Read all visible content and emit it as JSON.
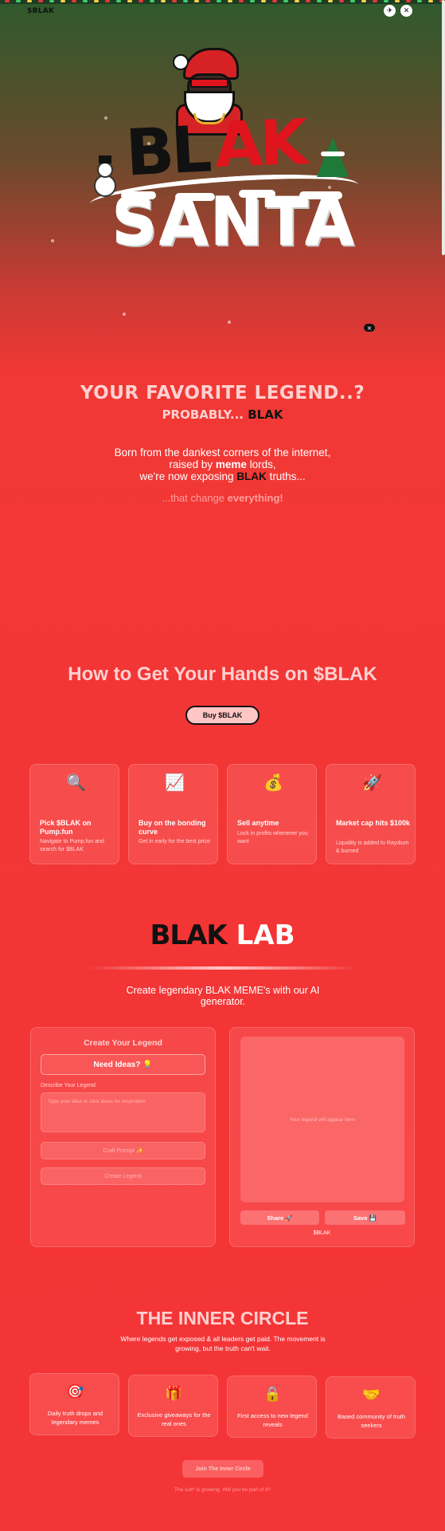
{
  "brand": {
    "prefix": "$",
    "name": "BLAK"
  },
  "header": {
    "telegram_icon": "telegram-icon",
    "x_icon": "x-logo-icon",
    "x_label": "✕",
    "telegram_label": "✈"
  },
  "hero": {
    "logo_bl": "BL",
    "logo_ak": "AK",
    "logo_santa": "SANTA"
  },
  "close_chip": "×",
  "tagline": {
    "line1": "YOUR FAVORITE LEGEND..?",
    "line2_prefix": "PROBABLY... ",
    "line2_blak": "BLAK"
  },
  "intro": {
    "line1": "Born from the dankest corners of the internet,",
    "line2_pre": "raised by ",
    "line2_bold": "meme",
    "line2_post": " lords,",
    "line3_pre": "we're now exposing ",
    "line3_blak": "BLAK",
    "line3_post": " truths...",
    "tail_pre": "...that change ",
    "tail_bold": "everything!"
  },
  "howto": {
    "title": "How to Get Your Hands on $BLAK",
    "buy_label": "Buy $BLAK",
    "steps": [
      {
        "icon": "🔍",
        "title": "Pick $BLAK on Pump.fun",
        "desc": "Navigate to Pump.fun and search for $BLAK"
      },
      {
        "icon": "📈",
        "title": "Buy on the bonding curve",
        "desc": "Get in early for the best price"
      },
      {
        "icon": "💰",
        "title": "Sell anytime",
        "desc": "Lock in profits whenever you want"
      },
      {
        "icon": "🚀",
        "title": "Market cap hits $100k",
        "desc": "Liquidity is added to Raydium & burned"
      }
    ]
  },
  "lab": {
    "title_blak": "BLAK",
    "title_lab": " LAB",
    "description": "Create legendary BLAK MEME's with our AI generator.",
    "panel_title": "Create Your Legend",
    "ideas_label": "Need Ideas? 💡",
    "field_label": "Describe Your Legend",
    "textarea_placeholder": "Type your idea or click ideas for inspiration",
    "craft_label": "Craft Prompt ✨",
    "create_label": "Create Legend",
    "preview_placeholder": "Your legend will appear here",
    "share_label": "Share 🚀",
    "save_label": "Save 💾",
    "watermark": "$BLAK"
  },
  "circle": {
    "title": "THE INNER CIRCLE",
    "description": "Where legends get exposed & all leaders get paid. The movement is growing, but the truth can't wait.",
    "perks": [
      {
        "icon": "🎯",
        "text": "Daily truth drops and legendary memes"
      },
      {
        "icon": "🎁",
        "text": "Exclusive giveaways for the real ones"
      },
      {
        "icon": "🔒",
        "text": "First access to new legend reveals"
      },
      {
        "icon": "🤝",
        "text": "Based community of truth seekers"
      }
    ],
    "join_label": "Join The Inner Circle",
    "footnote": "The cult* is growing. Will you be part of it?"
  },
  "colors": {
    "accent_red": "#e0141d",
    "text_pink": "#ffd0d0",
    "lights": [
      "#e23a3a",
      "#3bd16f",
      "#f6d34a"
    ]
  }
}
